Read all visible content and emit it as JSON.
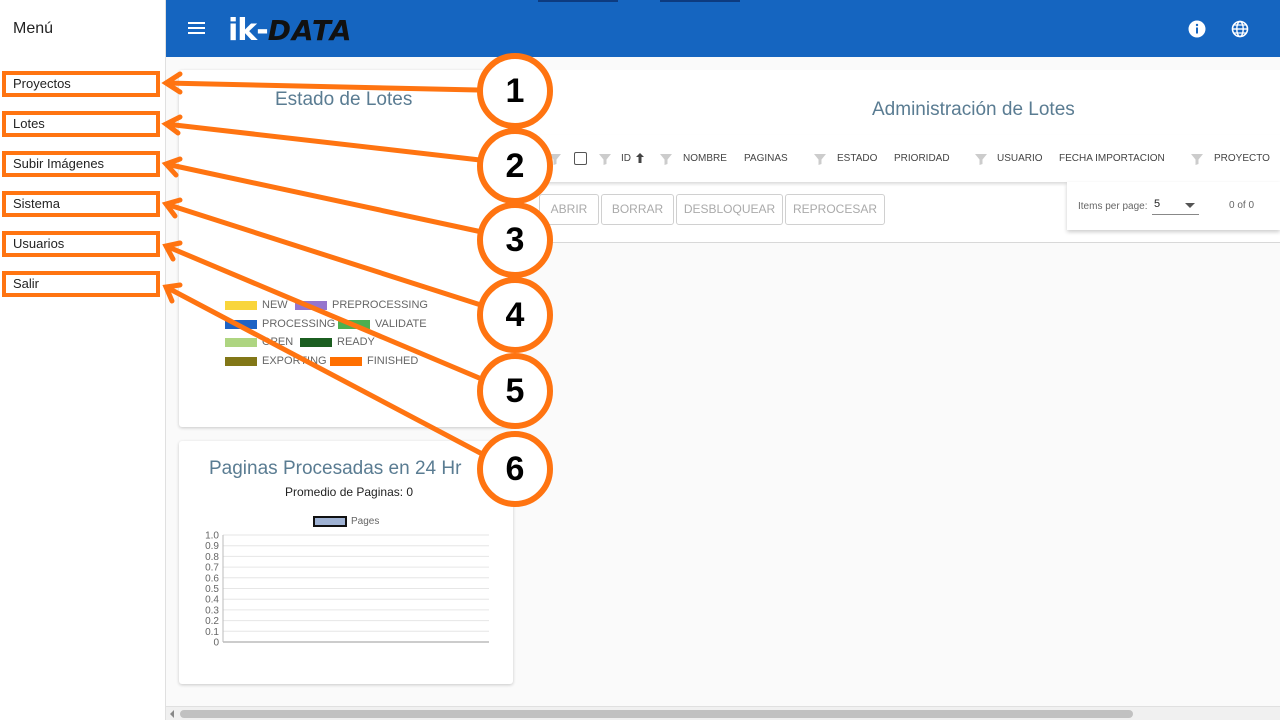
{
  "sidebar": {
    "title": "Menú",
    "items": [
      {
        "label": "Proyectos"
      },
      {
        "label": "Lotes"
      },
      {
        "label": "Subir Imágenes"
      },
      {
        "label": "Sistema"
      },
      {
        "label": "Usuarios"
      },
      {
        "label": "Salir"
      }
    ]
  },
  "header": {
    "logo_ik": "ik-",
    "logo_data": "DATA",
    "icons": [
      "menu-icon",
      "info-icon",
      "globe-icon"
    ],
    "color": "#1565c0"
  },
  "status_card": {
    "title": "Estado de Lotes",
    "legend": [
      {
        "label": "NEW",
        "color": "#f9d53b"
      },
      {
        "label": "PREPROCESSING",
        "color": "#9575cd"
      },
      {
        "label": "PROCESSING",
        "color": "#1e63c4"
      },
      {
        "label": "VALIDATE",
        "color": "#4caf50"
      },
      {
        "label": "OPEN",
        "color": "#aed581"
      },
      {
        "label": "READY",
        "color": "#1b5e20"
      },
      {
        "label": "EXPORTING",
        "color": "#827717"
      },
      {
        "label": "FINISHED",
        "color": "#ff6f00"
      }
    ]
  },
  "pages_card": {
    "title": "Paginas Procesadas en 24 Hr",
    "subtitle": "Promedio de Paginas: 0",
    "legend_label": "Pages"
  },
  "chart_data": {
    "type": "line",
    "series": [
      {
        "name": "Pages",
        "values": []
      }
    ],
    "ylim": [
      0,
      1.0
    ],
    "yticks": [
      "1.0",
      "0.9",
      "0.8",
      "0.7",
      "0.6",
      "0.5",
      "0.4",
      "0.3",
      "0.2",
      "0.1",
      "0"
    ],
    "grid": true,
    "legend": "top"
  },
  "admin": {
    "title": "Administración de Lotes",
    "columns": [
      "ID",
      "NOMBRE",
      "PAGINAS",
      "ESTADO",
      "PRIORIDAD",
      "USUARIO",
      "FECHA IMPORTACION",
      "PROYECTO"
    ],
    "sort_icon": "arrow-up-icon",
    "buttons": [
      "ABRIR",
      "BORRAR",
      "DESBLOQUEAR",
      "REPROCESAR"
    ]
  },
  "paginator": {
    "label": "Items per page:",
    "value": "5",
    "range": "0 of 0"
  },
  "callouts": [
    "1",
    "2",
    "3",
    "4",
    "5",
    "6"
  ],
  "accent": "#ff7411"
}
